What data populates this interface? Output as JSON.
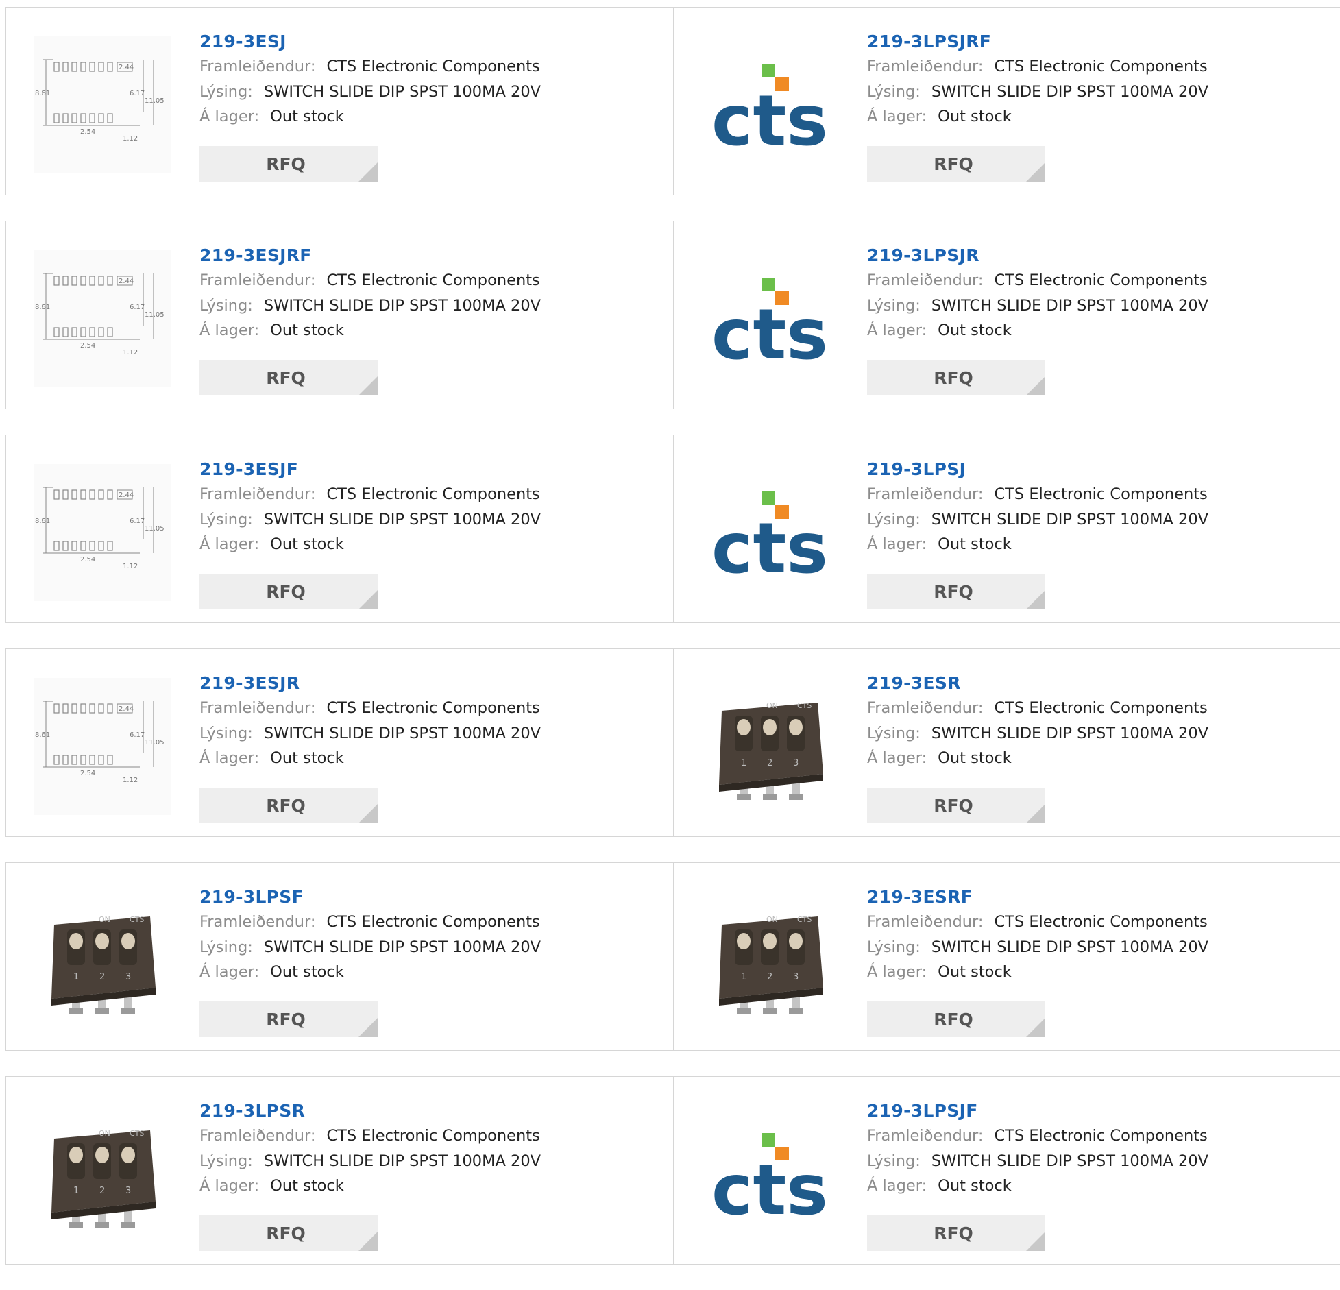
{
  "labels": {
    "manufacturer": "Framleiðendur:",
    "description": "Lýsing:",
    "stock": "Á lager:",
    "rfq": "RFQ"
  },
  "drawing_dims": {
    "d1": "2.44",
    "d2": "8.61",
    "d3": "6.17",
    "d4": "11.05",
    "d5": "2.54",
    "d6": "1.12"
  },
  "logo_text": "cts",
  "switch_text": {
    "on": "ON",
    "brand": "CTS",
    "n1": "1",
    "n2": "2",
    "n3": "3"
  },
  "products": [
    {
      "pn": "219-3ESJ",
      "image": "drawing",
      "manufacturer": "CTS Electronic Components",
      "description": "SWITCH SLIDE DIP SPST 100MA 20V",
      "stock": "Out stock"
    },
    {
      "pn": "219-3LPSJRF",
      "image": "cts-logo",
      "manufacturer": "CTS Electronic Components",
      "description": "SWITCH SLIDE DIP SPST 100MA 20V",
      "stock": "Out stock"
    },
    {
      "pn": "219-3ESJRF",
      "image": "drawing",
      "manufacturer": "CTS Electronic Components",
      "description": "SWITCH SLIDE DIP SPST 100MA 20V",
      "stock": "Out stock"
    },
    {
      "pn": "219-3LPSJR",
      "image": "cts-logo",
      "manufacturer": "CTS Electronic Components",
      "description": "SWITCH SLIDE DIP SPST 100MA 20V",
      "stock": "Out stock"
    },
    {
      "pn": "219-3ESJF",
      "image": "drawing",
      "manufacturer": "CTS Electronic Components",
      "description": "SWITCH SLIDE DIP SPST 100MA 20V",
      "stock": "Out stock"
    },
    {
      "pn": "219-3LPSJ",
      "image": "cts-logo",
      "manufacturer": "CTS Electronic Components",
      "description": "SWITCH SLIDE DIP SPST 100MA 20V",
      "stock": "Out stock"
    },
    {
      "pn": "219-3ESJR",
      "image": "drawing",
      "manufacturer": "CTS Electronic Components",
      "description": "SWITCH SLIDE DIP SPST 100MA 20V",
      "stock": "Out stock"
    },
    {
      "pn": "219-3ESR",
      "image": "switch-photo",
      "manufacturer": "CTS Electronic Components",
      "description": "SWITCH SLIDE DIP SPST 100MA 20V",
      "stock": "Out stock"
    },
    {
      "pn": "219-3LPSF",
      "image": "switch-photo",
      "manufacturer": "CTS Electronic Components",
      "description": "SWITCH SLIDE DIP SPST 100MA 20V",
      "stock": "Out stock"
    },
    {
      "pn": "219-3ESRF",
      "image": "switch-photo",
      "manufacturer": "CTS Electronic Components",
      "description": "SWITCH SLIDE DIP SPST 100MA 20V",
      "stock": "Out stock"
    },
    {
      "pn": "219-3LPSR",
      "image": "switch-photo",
      "manufacturer": "CTS Electronic Components",
      "description": "SWITCH SLIDE DIP SPST 100MA 20V",
      "stock": "Out stock"
    },
    {
      "pn": "219-3LPSJF",
      "image": "cts-logo",
      "manufacturer": "CTS Electronic Components",
      "description": "SWITCH SLIDE DIP SPST 100MA 20V",
      "stock": "Out stock"
    }
  ],
  "colors": {
    "part_number": "#1b63b3",
    "label": "#8c8c8c",
    "value": "#222222",
    "rfq_bg": "#eeeeee",
    "logo_blue": "#1f5a8a",
    "logo_green": "#6bbf4a",
    "logo_orange": "#f08a24"
  }
}
